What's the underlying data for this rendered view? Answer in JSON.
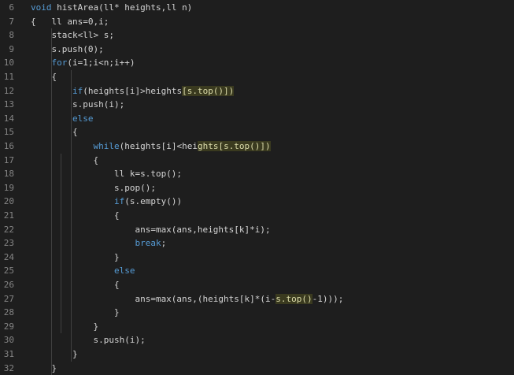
{
  "editor": {
    "lines": [
      {
        "n": "6",
        "tokens": [
          {
            "t": "void",
            "c": "kw"
          },
          {
            "t": " histArea(ll* heights,ll n)",
            "c": ""
          }
        ]
      },
      {
        "n": "7",
        "tokens": [
          {
            "t": "{   ll ans=0,i;",
            "c": ""
          }
        ]
      },
      {
        "n": "8",
        "tokens": [
          {
            "t": "    stack<ll> s;",
            "c": ""
          }
        ]
      },
      {
        "n": "9",
        "tokens": [
          {
            "t": "    s.push(0);",
            "c": ""
          }
        ]
      },
      {
        "n": "10",
        "tokens": [
          {
            "t": "    ",
            "c": ""
          },
          {
            "t": "for",
            "c": "kw"
          },
          {
            "t": "(i=1;i<n;i++)",
            "c": ""
          }
        ]
      },
      {
        "n": "11",
        "tokens": [
          {
            "t": "    {",
            "c": ""
          }
        ]
      },
      {
        "n": "12",
        "tokens": [
          {
            "t": "        ",
            "c": ""
          },
          {
            "t": "if",
            "c": "kw"
          },
          {
            "t": "(heights[i]>heights",
            "c": ""
          },
          {
            "t": "[s.top()])",
            "c": "hl"
          }
        ]
      },
      {
        "n": "13",
        "tokens": [
          {
            "t": "        s.push(i);",
            "c": ""
          }
        ]
      },
      {
        "n": "14",
        "tokens": [
          {
            "t": "        ",
            "c": ""
          },
          {
            "t": "else",
            "c": "kw"
          }
        ]
      },
      {
        "n": "15",
        "tokens": [
          {
            "t": "        {",
            "c": ""
          }
        ]
      },
      {
        "n": "16",
        "tokens": [
          {
            "t": "            ",
            "c": ""
          },
          {
            "t": "while",
            "c": "kw"
          },
          {
            "t": "(heights[i]<hei",
            "c": ""
          },
          {
            "t": "ghts[s.top()])",
            "c": "hl"
          }
        ]
      },
      {
        "n": "17",
        "tokens": [
          {
            "t": "            {",
            "c": ""
          }
        ]
      },
      {
        "n": "18",
        "tokens": [
          {
            "t": "                ll k=s.top();",
            "c": ""
          }
        ]
      },
      {
        "n": "19",
        "tokens": [
          {
            "t": "                s.pop();",
            "c": ""
          }
        ]
      },
      {
        "n": "20",
        "tokens": [
          {
            "t": "                ",
            "c": ""
          },
          {
            "t": "if",
            "c": "kw"
          },
          {
            "t": "(s.empty())",
            "c": ""
          }
        ]
      },
      {
        "n": "21",
        "tokens": [
          {
            "t": "                {",
            "c": ""
          }
        ]
      },
      {
        "n": "22",
        "tokens": [
          {
            "t": "                    ans=max(ans,heights[k]*i);",
            "c": ""
          }
        ]
      },
      {
        "n": "23",
        "tokens": [
          {
            "t": "                    ",
            "c": ""
          },
          {
            "t": "break",
            "c": "kw"
          },
          {
            "t": ";",
            "c": ""
          }
        ]
      },
      {
        "n": "24",
        "tokens": [
          {
            "t": "                }",
            "c": ""
          }
        ]
      },
      {
        "n": "25",
        "tokens": [
          {
            "t": "                ",
            "c": ""
          },
          {
            "t": "else",
            "c": "kw"
          }
        ]
      },
      {
        "n": "26",
        "tokens": [
          {
            "t": "                {",
            "c": ""
          }
        ]
      },
      {
        "n": "27",
        "tokens": [
          {
            "t": "                    ans=max(ans,(heights[k]*(i-",
            "c": ""
          },
          {
            "t": "s.top()",
            "c": "hl"
          },
          {
            "t": "-1)));",
            "c": ""
          }
        ]
      },
      {
        "n": "28",
        "tokens": [
          {
            "t": "                }",
            "c": ""
          }
        ]
      },
      {
        "n": "29",
        "tokens": [
          {
            "t": "            }",
            "c": ""
          }
        ]
      },
      {
        "n": "30",
        "tokens": [
          {
            "t": "            s.push(i);",
            "c": ""
          }
        ]
      },
      {
        "n": "31",
        "tokens": [
          {
            "t": "        }",
            "c": ""
          }
        ]
      },
      {
        "n": "32",
        "tokens": [
          {
            "t": "    }",
            "c": ""
          }
        ]
      }
    ]
  },
  "colors": {
    "background": "#1e1e1e",
    "text": "#d4d4d4",
    "keyword": "#569cd6",
    "line_number": "#858585",
    "highlight_bg": "#3a3a1f"
  }
}
